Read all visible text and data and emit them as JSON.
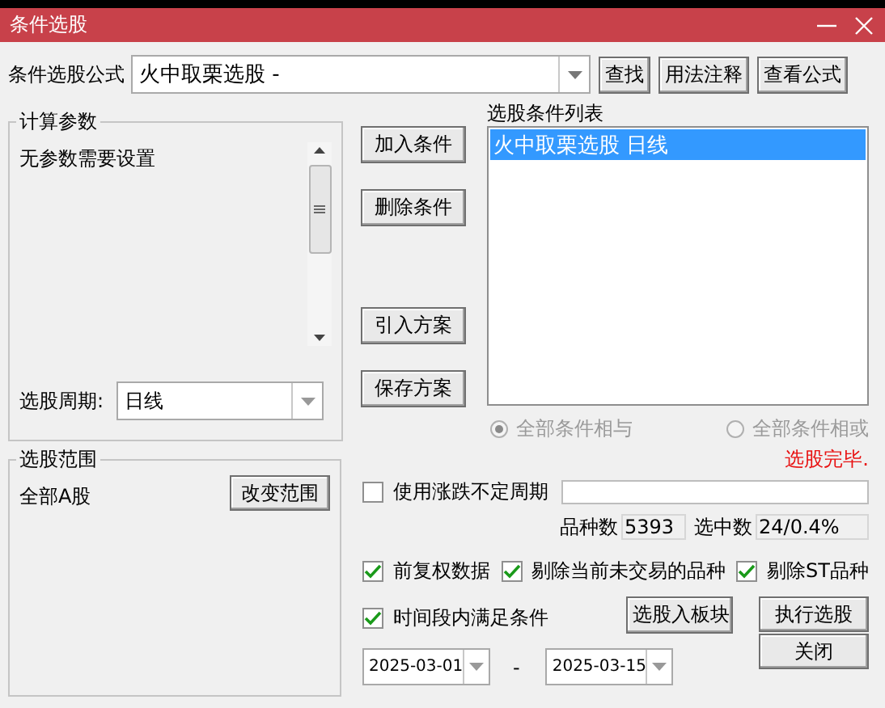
{
  "window": {
    "title": "条件选股"
  },
  "formula": {
    "label": "条件选股公式",
    "value": "火中取栗选股 -"
  },
  "top_buttons": [
    "查找",
    "用法注释",
    "查看公式"
  ],
  "params_group": {
    "title": "计算参数",
    "message": "无参数需要设置",
    "period_label": "选股周期:",
    "period_value": "日线"
  },
  "condition_buttons": [
    "加入条件",
    "删除条件",
    "引入方案",
    "保存方案"
  ],
  "condition_list": {
    "title": "选股条件列表",
    "items": [
      {
        "label": "火中取栗选股  日线",
        "selected": true
      }
    ]
  },
  "logic_options": [
    {
      "label": "全部条件相与",
      "selected": true,
      "disabled": true
    },
    {
      "label": "全部条件相或",
      "selected": false,
      "disabled": true
    }
  ],
  "range_group": {
    "title": "选股范围",
    "value": "全部A股",
    "button": "改变范围"
  },
  "status": "选股完毕.",
  "variable_period": {
    "label": "使用涨跌不定周期",
    "checked": false
  },
  "counts": [
    {
      "label": "品种数",
      "value": "5393"
    },
    {
      "label": "选中数",
      "value": "24/0.4%"
    }
  ],
  "options": [
    {
      "label": "前复权数据",
      "checked": true
    },
    {
      "label": "剔除当前未交易的品种",
      "checked": true
    },
    {
      "label": "剔除ST品种",
      "checked": true
    }
  ],
  "time_range": {
    "label": "时间段内满足条件",
    "checked": true,
    "start": "2025-03-01",
    "separator": "-",
    "end": "2025-03-15"
  },
  "action_buttons": [
    "选股入板块",
    "执行选股",
    "关闭"
  ]
}
